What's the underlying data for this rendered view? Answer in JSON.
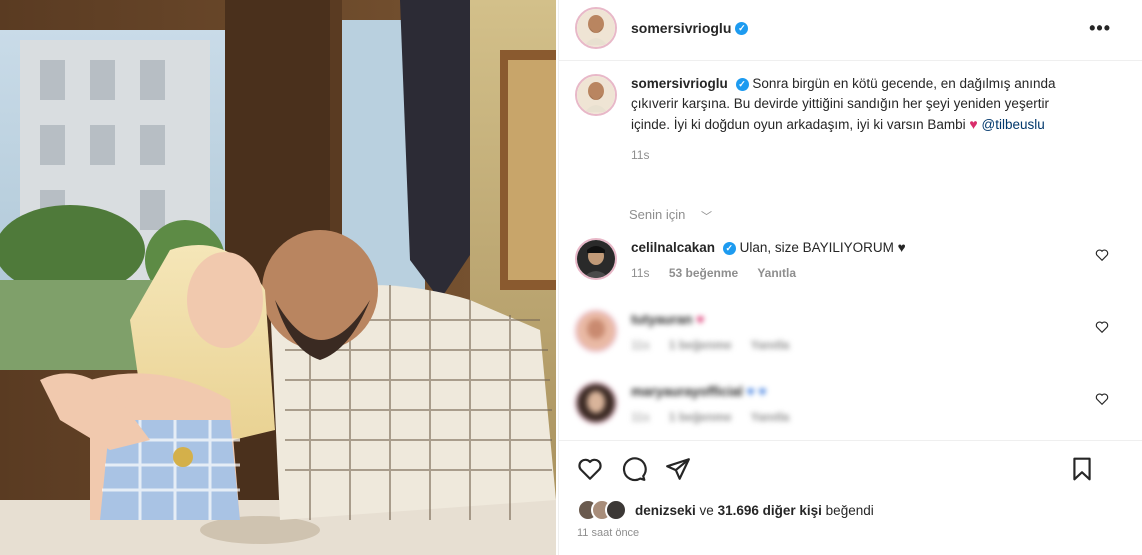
{
  "post": {
    "username": "somersivrioglu",
    "verified_mark": "✓",
    "more_icon": "•••",
    "caption": {
      "username": "somersivrioglu",
      "text": "Sonra birgün en kötü gecende, en dağılmış anında çıkıverir karşına. Bu devirde yittiğini sandığın her şeyi yeniden yeşertir içinde. İyi ki doğdun oyun arkadaşım, iyi ki varsın Bambi",
      "heart": "♥",
      "mention": "@tilbeuslu",
      "time": "11s"
    },
    "sort_label": "Senin için",
    "sort_chevron": "﹀"
  },
  "comments": [
    {
      "username": "celilnalcakan",
      "text": "Ulan, size BAYILIYORUM",
      "trailing_emoji": "♥",
      "time": "11s",
      "likes": "53 beğenme",
      "reply": "Yanıtla"
    },
    {
      "username": "tutyauran",
      "text": "♥",
      "time": "11s",
      "likes": "1 beğenme",
      "reply": "Yanıtla"
    },
    {
      "username": "maryaurayofficial",
      "text": "♥ ♥",
      "time": "11s",
      "likes": "1 beğenme",
      "reply": "Yanıtla"
    }
  ],
  "actions": {
    "like": "heart-outline-icon",
    "comment": "comment-bubble-icon",
    "share": "paper-plane-icon",
    "save": "bookmark-icon"
  },
  "likes": {
    "user": "denizseki",
    "connector": "ve",
    "others": "31.696 diğer kişi",
    "suffix": "beğendi"
  },
  "timestamp": "11 saat önce",
  "colors": {
    "verified": "#1d9bf0",
    "heart": "#d92d6b",
    "mention": "#00376b",
    "muted": "#8e8e8e"
  }
}
